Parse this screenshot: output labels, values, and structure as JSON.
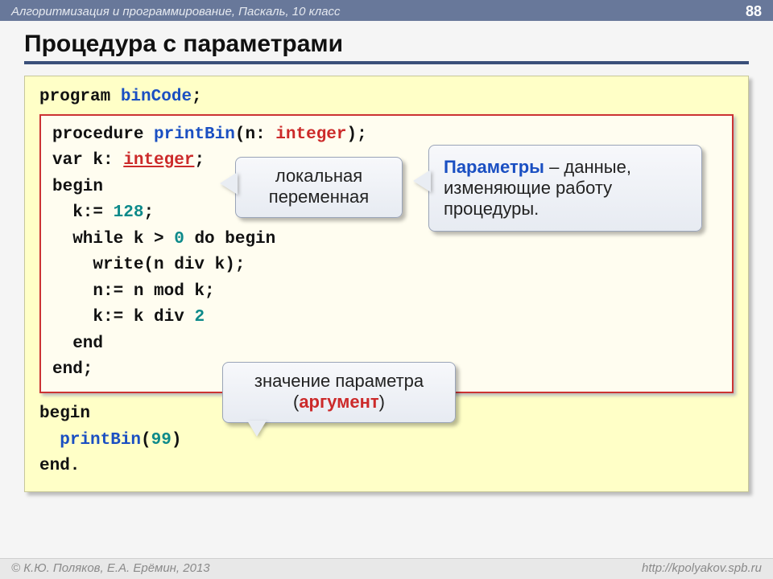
{
  "header": {
    "course": "Алгоритмизация и программирование, Паскаль, 10 класс",
    "page_no": "88"
  },
  "title": "Процедура с параметрами",
  "code": {
    "program_kw": "program",
    "program_name": "binCode",
    "semicolon": ";",
    "proc": {
      "procedure_kw": "procedure",
      "name": "printBin",
      "param_open": "(n: ",
      "param_type": "integer",
      "param_close": ");",
      "var_kw": "var",
      "var_decl_pre": " k: ",
      "var_type": "integer",
      "var_decl_post": ";",
      "begin_kw": "begin",
      "l_assign_pre": "  k:= ",
      "l_assign_val": "128",
      "l_assign_post": ";",
      "while_pre": "  while k > ",
      "while_zero": "0",
      "while_post": " do begin",
      "write_ln": "    write(n div k);",
      "nmod_ln": "    n:= n mod k;",
      "kdiv_pre": "    k:= k div ",
      "kdiv_two": "2",
      "end1": "  end",
      "end2": "end;"
    },
    "main": {
      "begin_kw": "begin",
      "call_name": "printBin",
      "call_open": "(",
      "call_arg": "99",
      "call_close": ")",
      "end_kw": "end."
    }
  },
  "callouts": {
    "local_var": "локальная переменная",
    "params_bold": "Параметры",
    "params_rest": " – данные, изменяющие работу процедуры.",
    "arg_pre": "значение параметра (",
    "arg_hi": "аргумент",
    "arg_post": ")"
  },
  "footer": {
    "credits": "© К.Ю. Поляков, Е.А. Ерёмин, 2013",
    "url": "http://kpolyakov.spb.ru"
  }
}
